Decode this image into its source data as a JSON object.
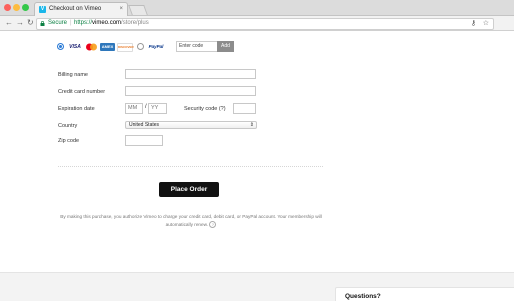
{
  "browser": {
    "tab_title": "Checkout on Vimeo",
    "tab_favicon": "V",
    "close_glyph": "×",
    "secure_label": "Secure",
    "url_scheme": "https://",
    "url_host": "vimeo.com",
    "url_path": "/store/plus"
  },
  "payment": {
    "methods": [
      "visa-card",
      "mastercard",
      "amex",
      "discover",
      "paypal"
    ],
    "selected": "card",
    "visa_label": "VISA",
    "amex_label": "AMEX",
    "discover_label": "DISCOVER",
    "paypal_label": "PayPal",
    "promo_placeholder": "Enter code",
    "promo_button": "Add"
  },
  "form": {
    "billing_name_label": "Billing name",
    "card_number_label": "Credit card number",
    "expiration_label": "Expiration date",
    "month_placeholder": "MM",
    "year_placeholder": "YY",
    "security_label": "Security code (?)",
    "country_label": "Country",
    "country_value": "United States",
    "zip_label": "Zip code",
    "place_order": "Place Order"
  },
  "disclaimer": {
    "text": "By making this purchase, you authorize Vimeo to charge your credit card, debit card, or PayPal account. Your membership will automatically renew.",
    "help_glyph": "?"
  },
  "sidebar": {
    "questions_title": "Questions?"
  },
  "colors": {
    "place_order_bg": "#111111",
    "secure_green": "#0b8043",
    "radio_blue": "#2b7bd6"
  }
}
